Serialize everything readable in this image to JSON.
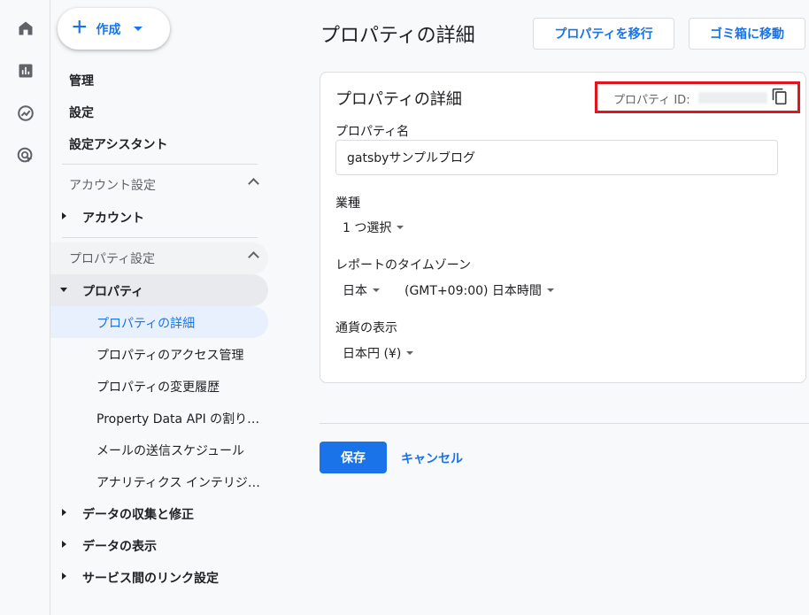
{
  "rail": {
    "icons": [
      "home-icon",
      "reports-icon",
      "explore-icon",
      "advertising-icon"
    ]
  },
  "nav": {
    "create_label": "作成",
    "top_items": [
      "管理",
      "設定",
      "設定アシスタント"
    ],
    "account_section": "アカウント設定",
    "account_item": "アカウント",
    "property_section": "プロパティ設定",
    "property_item": "プロパティ",
    "property_sub": [
      "プロパティの詳細",
      "プロパティのアクセス管理",
      "プロパティの変更履歴",
      "Property Data API の割り当て...",
      "メールの送信スケジュール",
      "アナリティクス インテリジェンス..."
    ],
    "more_groups": [
      "データの収集と修正",
      "データの表示",
      "サービス間のリンク設定"
    ]
  },
  "main": {
    "page_title": "プロパティの詳細",
    "move_button": "プロパティを移行",
    "trash_button": "ゴミ箱に移動",
    "card": {
      "title": "プロパティの詳細",
      "property_id_label": "プロパティ ID:",
      "name_label": "プロパティ名",
      "name_value": "gatsbyサンプルブログ",
      "industry_label": "業種",
      "industry_value": "1 つ選択",
      "timezone_label": "レポートのタイムゾーン",
      "timezone_country": "日本",
      "timezone_value": "(GMT+09:00) 日本時間",
      "currency_label": "通貨の表示",
      "currency_value": "日本円 (¥)"
    },
    "save_button": "保存",
    "cancel_button": "キャンセル"
  },
  "colors": {
    "accent": "#1a73e8",
    "highlight_box": "#e0161e",
    "selected_bg": "#e8f0fe"
  }
}
